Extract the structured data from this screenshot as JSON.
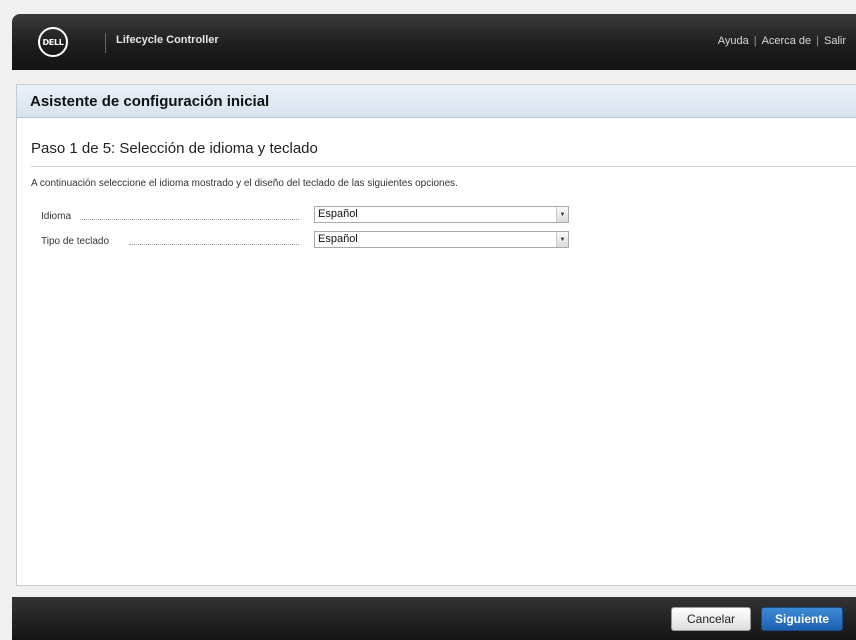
{
  "header": {
    "logo_text": "DELL",
    "app_title": "Lifecycle Controller",
    "links": [
      "Ayuda",
      "Acerca de",
      "Salir"
    ],
    "link_separator": "|"
  },
  "panel": {
    "title": "Asistente de configuración inicial",
    "step_title": "Paso 1 de 5: Selección de idioma y teclado",
    "description": "A continuación seleccione el idioma mostrado y el diseño del teclado de las siguientes opciones."
  },
  "fields": [
    {
      "label": "Idioma",
      "value": "Español"
    },
    {
      "label": "Tipo de teclado",
      "value": "Español"
    }
  ],
  "footer": {
    "cancel_label": "Cancelar",
    "next_label": "Siguiente"
  },
  "colors": {
    "topbar": "#1c1c1c",
    "panel_header": "#d7e3ef",
    "primary_button": "#2a6fc2"
  }
}
